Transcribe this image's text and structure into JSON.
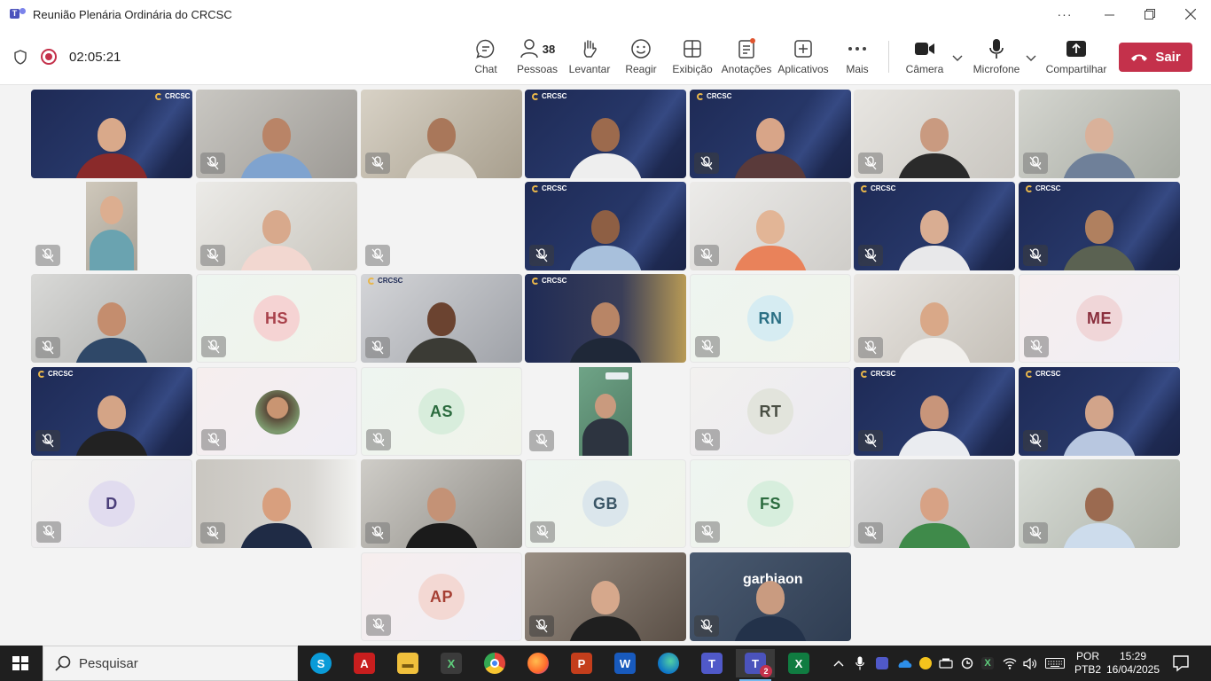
{
  "window": {
    "title": "Reunião Plenária Ordinária do CRCSC",
    "more": "···"
  },
  "meeting": {
    "timer": "02:05:21",
    "people_count": "38",
    "toolbar": {
      "chat": "Chat",
      "pessoas": "Pessoas",
      "levantar": "Levantar",
      "reagir": "Reagir",
      "exibicao": "Exibição",
      "anotacoes": "Anotações",
      "aplicativos": "Aplicativos",
      "mais": "Mais",
      "camera": "Câmera",
      "microfone": "Microfone",
      "compartilhar": "Compartilhar",
      "sair": "Sair"
    },
    "initials": [
      "HS",
      "RN",
      "ME",
      "AS",
      "RT",
      "D",
      "GB",
      "FS",
      "AP"
    ],
    "crc_logo": "CRCSC",
    "garbia_logo": "garbiaon"
  },
  "taskbar": {
    "search": "Pesquisar",
    "lang_top": "POR",
    "lang_bottom": "PTB2",
    "time": "15:29",
    "date": "16/04/2025",
    "teams_badge": "2"
  },
  "colors": {
    "accent": "#4b53bc",
    "leave": "#c4314b",
    "taskbar": "#1f1f1f"
  }
}
